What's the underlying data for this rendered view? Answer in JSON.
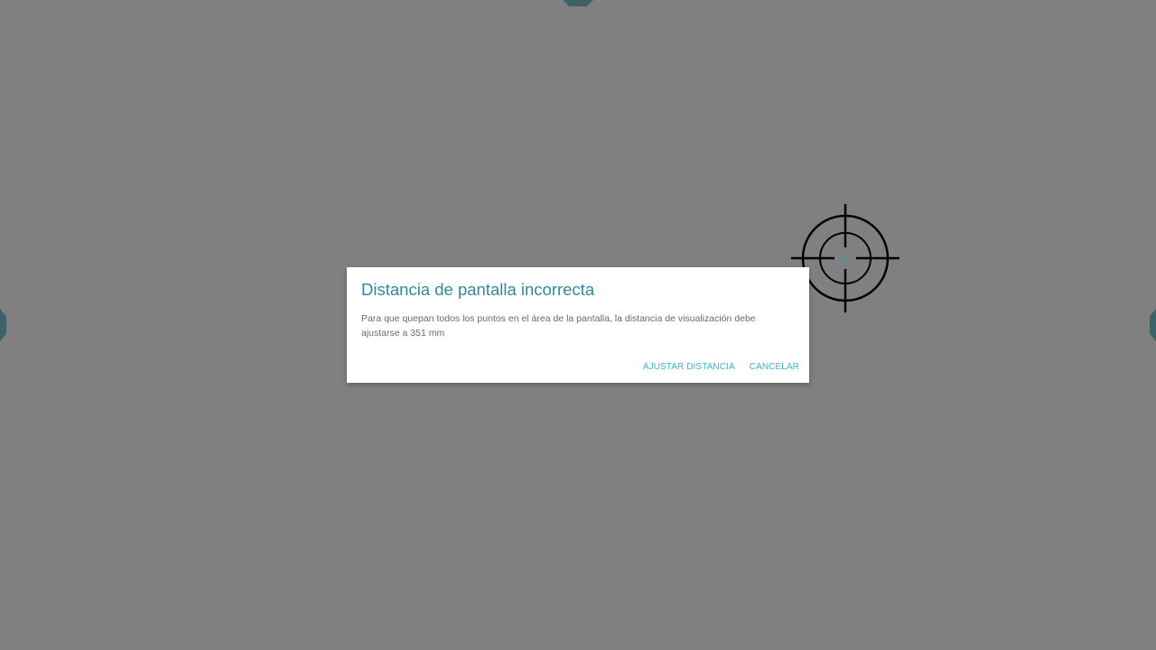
{
  "dialog": {
    "title": "Distancia de pantalla incorrecta",
    "message": "Para que quepan todos los puntos en el área de la pantalla, la distancia de visualización debe ajustarse a 351 mm",
    "primary_action": "AJUSTAR DISTANCIA",
    "secondary_action": "CANCELAR"
  },
  "calibration": {
    "target_icon": "crosshair-target-icon",
    "edge_marker_icon": "octagon-marker-icon"
  },
  "colors": {
    "overlay": "#808080",
    "title": "#2d8aa5",
    "body_text": "#6a6a6a",
    "action_text": "#3fb3cf",
    "marker": "#3d6369",
    "target_stroke": "#000000",
    "target_center": "#3f8f9a"
  }
}
